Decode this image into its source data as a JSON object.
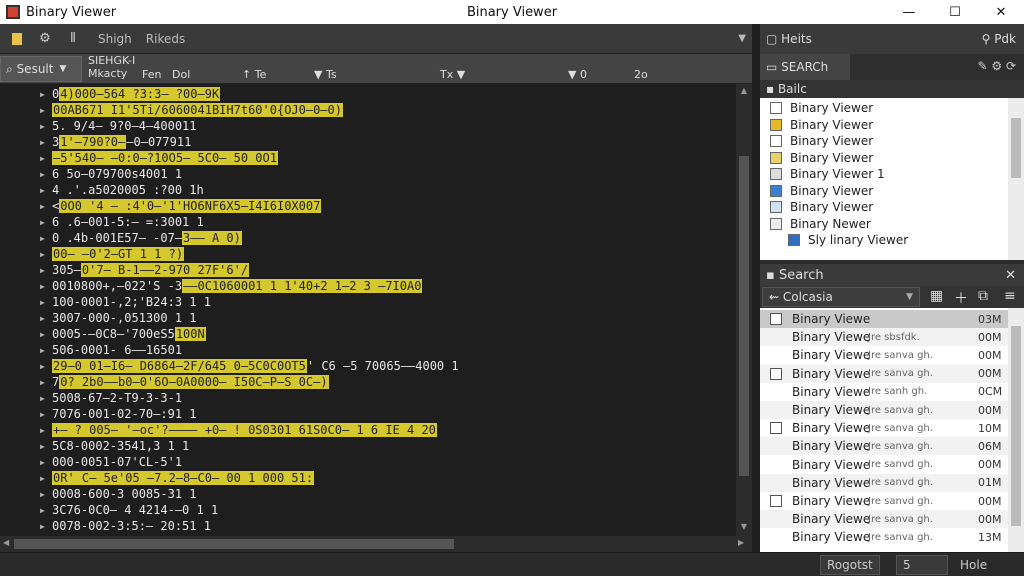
{
  "window": {
    "app_name": "Binary Viewer",
    "title": "Binary Viewer",
    "minimize": "—",
    "maximize": "☐",
    "close": "✕"
  },
  "toolbar": {
    "items": [
      "Shigh",
      "Rikeds"
    ],
    "icons": [
      "file-icon",
      "tools-icon",
      "columns-icon"
    ]
  },
  "left_header": {
    "result_label": "Sesult",
    "meta_line1": "SIEHGK-I",
    "meta_line2": "Mkacty",
    "col_fen": "Fen",
    "col_dol": "Dol",
    "col_te": "Te",
    "col_ts": "Ts",
    "col_tx": "Tx",
    "col_0": "0",
    "col_2o": "2o"
  },
  "code_lines": [
    {
      "pre": "0 ",
      "hl": "4)000‒564 ?3:3‒ ?00‒9K",
      "post": ""
    },
    {
      "pre": "",
      "hl": "00AB671 I1'5Ti/6060041BIH7t60'0{OJ0‒0‒0)",
      "post": ""
    },
    {
      "pre": "5. 9/4‒ 9?0‒4‒400011",
      "hl": "",
      "post": ""
    },
    {
      "pre": "3 ",
      "hl": "1'‒790?0‒",
      "post": "‒0‒077911"
    },
    {
      "pre": "",
      "hl": "‒5'540‒ ‒0:0‒?10O5‒ 5C0‒ 50 0O1",
      "post": ""
    },
    {
      "pre": "6 5o‒079700s4001 1",
      "hl": "",
      "post": ""
    },
    {
      "pre": "4 .'.a5020005 :?00 1h",
      "hl": "",
      "post": ""
    },
    {
      "pre": "< ",
      "hl": "0O0 '4 ‒ :4'0‒'1'HO6NF6X5‒I4I6I0X007",
      "post": ""
    },
    {
      "pre": "6 .6‒001-5:‒ =:3001 1",
      "hl": "",
      "post": ""
    },
    {
      "pre": "0 .4b-001E57‒ -07‒",
      "hl": "3‒‒ A 0)",
      "post": ""
    },
    {
      "pre": "",
      "hl": "00‒ ‒0'2‒GT 1 1 ?)",
      "post": ""
    },
    {
      "pre": "305‒",
      "hl": "0'7‒ B-1‒‒2-970 27F'6'/",
      "post": ""
    },
    {
      "pre": "0010800+,‒022'S -3",
      "hl": "‒‒0C1060001 1 1'40+2 1‒2 3 ‒7I0A0",
      "post": ""
    },
    {
      "pre": "100-0001-,2;'B24:3 1 1",
      "hl": "",
      "post": ""
    },
    {
      "pre": "3007-000-,051300 1 1",
      "hl": "",
      "post": ""
    },
    {
      "pre": "0005-‒0C8‒'700eS5",
      "hl": "100N",
      "post": ""
    },
    {
      "pre": "506-0001-  6‒‒16501",
      "hl": "",
      "post": ""
    },
    {
      "pre": "",
      "hl": "29‒0 01‒I6‒ D6864‒2F/645 0‒5C0C0OT5",
      "post": " ' C6 ‒5 70065‒‒4000 1"
    },
    {
      "pre": "7",
      "hl": "0? 2b0‒‒b0‒0'6O‒0A0000‒ I50C‒P‒S 0C‒)",
      "post": ""
    },
    {
      "pre": "5008-67‒2-T9-3-3-1",
      "hl": "",
      "post": ""
    },
    {
      "pre": "7076-001-02-70‒:91 1",
      "hl": "",
      "post": ""
    },
    {
      "pre": "",
      "hl": "+‒ ? 005‒ '‒oc'?‒‒‒‒ +0‒ ! 0S0301 61S0C0‒ 1 6 IE 4 20",
      "post": ""
    },
    {
      "pre": "5C8-0002-3541,3 1 1",
      "hl": "",
      "post": ""
    },
    {
      "pre": "000-0051-07'CL-5'1",
      "hl": "",
      "post": ""
    },
    {
      "pre": "",
      "hl": "0R' C‒ 5e'05 ‒7.2‒8‒C0‒ 00 1 000 51:",
      "post": ""
    },
    {
      "pre": "0008-600-3 0085-31 1",
      "hl": "",
      "post": ""
    },
    {
      "pre": "3C76-0C0‒ 4 4214-‒0 1 1",
      "hl": "",
      "post": ""
    },
    {
      "pre": "0078-002-3:5:‒ 20:51 1",
      "hl": "",
      "post": ""
    }
  ],
  "right_panel": {
    "header": "Heits",
    "header_right": "Pdk",
    "tab": "SEARCh",
    "sub": "Bailc",
    "tree": [
      "Binary Viewer",
      "Binary Viewer",
      "Binary Viewer",
      "Binary Viewer",
      "Binary Viewer 1",
      "Binary Viewer",
      "Binary Viewer",
      "Binary Newer",
      "Sly linary Viewer"
    ],
    "search_title": "Search",
    "search_value": "Colcasia",
    "results": [
      {
        "name": "Binary Viewe",
        "desc": "",
        "size": "03M"
      },
      {
        "name": "Binary Viewe",
        "desc": "Jre sbsfdk.",
        "size": "00M"
      },
      {
        "name": "Binary Viewe",
        "desc": "Jre sanva gh.",
        "size": "00M"
      },
      {
        "name": "Binary Viewe",
        "desc": "Jre sanva gh.",
        "size": "00M"
      },
      {
        "name": "Binary Viewe",
        "desc": "Jre sanh gh.",
        "size": "0CM"
      },
      {
        "name": "Binary Viewe",
        "desc": "Jre sanva gh.",
        "size": "00M"
      },
      {
        "name": "Binary Viewe",
        "desc": "Jre sanva gh.",
        "size": "10M"
      },
      {
        "name": "Binary Viewe",
        "desc": "Jre sanva gh.",
        "size": "06M"
      },
      {
        "name": "Binary Viewe",
        "desc": "Jre sanvd gh.",
        "size": "00M"
      },
      {
        "name": "Binary Viewe",
        "desc": "Jre sanvd gh.",
        "size": "01M"
      },
      {
        "name": "Binary Viewe",
        "desc": "Jre sanvd gh.",
        "size": "00M"
      },
      {
        "name": "Binary Viewe",
        "desc": "Jre sanva gh.",
        "size": "00M"
      },
      {
        "name": "Binary Viewe",
        "desc": "Jre sanva gh.",
        "size": "13M"
      }
    ]
  },
  "status": {
    "left": "Rogotst",
    "box": "5",
    "right": "Hole"
  }
}
